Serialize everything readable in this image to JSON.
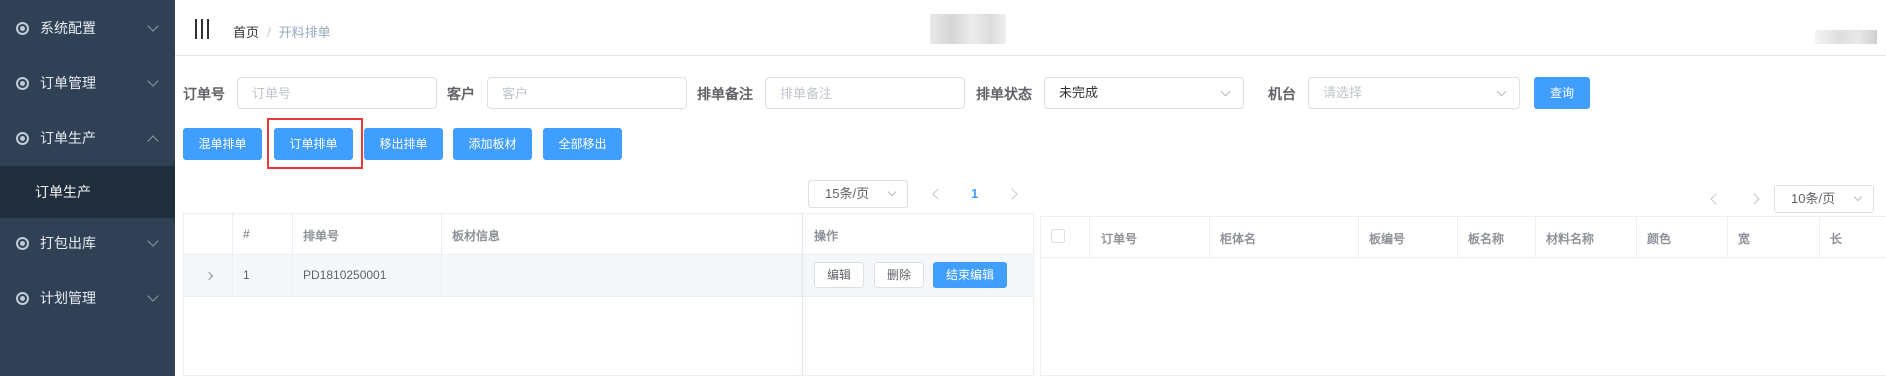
{
  "sidebar": {
    "items": [
      {
        "label": "系统配置",
        "icon": "gear-icon",
        "expanded": false
      },
      {
        "label": "订单管理",
        "icon": "gear-icon",
        "expanded": false
      },
      {
        "label": "订单生产",
        "icon": "gear-icon",
        "expanded": true
      },
      {
        "label": "打包出库",
        "icon": "gear-icon",
        "expanded": false
      },
      {
        "label": "计划管理",
        "icon": "gear-icon",
        "expanded": false
      }
    ],
    "active_sub": "订单生产"
  },
  "breadcrumb": {
    "home": "首页",
    "separator": "/",
    "current": "开料排单"
  },
  "filters": {
    "order_no": {
      "label": "订单号",
      "placeholder": "订单号"
    },
    "customer": {
      "label": "客户",
      "placeholder": "客户"
    },
    "remark": {
      "label": "排单备注",
      "placeholder": "排单备注"
    },
    "status": {
      "label": "排单状态",
      "value": "未完成"
    },
    "machine": {
      "label": "机台",
      "placeholder": "请选择"
    },
    "query_button": "查询"
  },
  "actions": {
    "mix_schedule": "混单排单",
    "order_schedule": "订单排单",
    "remove_schedule": "移出排单",
    "add_board": "添加板材",
    "remove_all": "全部移出"
  },
  "left_pagination": {
    "page_size": "15条/页",
    "current_page": "1"
  },
  "left_table": {
    "headers": [
      "#",
      "排单号",
      "板材信息",
      "操作"
    ],
    "rows": [
      {
        "index": "1",
        "schedule_no": "PD1810250001",
        "board_info": "",
        "actions": [
          "编辑",
          "删除",
          "结束编辑"
        ]
      }
    ]
  },
  "right_pagination": {
    "page_size": "10条/页"
  },
  "right_table": {
    "headers": [
      "订单号",
      "柜体名",
      "板编号",
      "板名称",
      "材料名称",
      "颜色",
      "宽",
      "长"
    ]
  },
  "colors": {
    "sidebar_bg": "#304156",
    "sidebar_sub_bg": "#1f2d3d",
    "primary": "#409eff",
    "highlight": "#e83a3a"
  }
}
